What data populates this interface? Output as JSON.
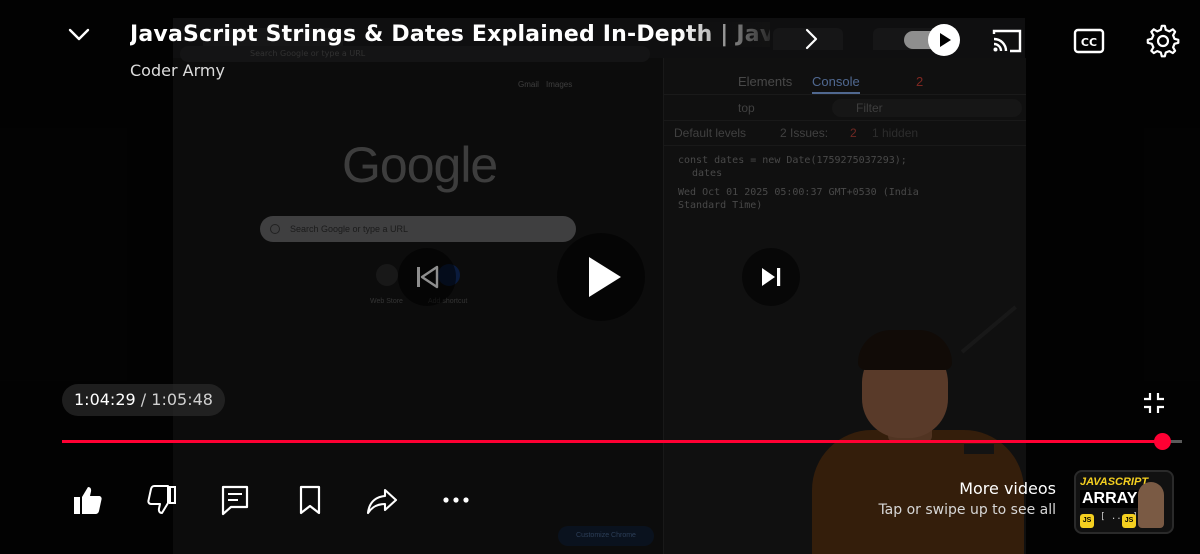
{
  "video": {
    "title": "JavaScript Strings & Dates Explained In-Depth | Javas",
    "channel": "Coder Army"
  },
  "playback": {
    "current_time": "1:04:29",
    "separator": "/",
    "duration": "1:05:48",
    "progress_fraction": 0.982,
    "state": "paused"
  },
  "autoplay": {
    "enabled": true
  },
  "more_videos": {
    "title": "More videos",
    "subtitle": "Tap or swipe up to see all",
    "next_thumbnail": {
      "label_top": "JAVASCRIPT",
      "label_main": "ARRAY",
      "label_bracket": "[ ... ]",
      "badge": "JS"
    }
  },
  "frame": {
    "chrome": {
      "address_placeholder": "Search Google or type a URL",
      "links": [
        "Gmail",
        "Images"
      ],
      "logo": "Google",
      "search_placeholder": "Search Google or type a URL",
      "shortcuts": [
        "Web Store",
        "Add shortcut"
      ],
      "customize_label": "Customize Chrome"
    },
    "devtools": {
      "tabs": [
        "Elements",
        "Console"
      ],
      "active_tab": "Console",
      "error_count": "2",
      "context": "top",
      "filter_placeholder": "Filter",
      "levels": "Default levels",
      "issues": "2 Issues:",
      "issues_count": "2",
      "hidden": "1 hidden",
      "input_line_1": "const dates = new Date(1759275037293);",
      "input_line_2": "dates",
      "output_line_1": "Wed Oct 01 2025 05:00:37 GMT+0530 (India",
      "output_line_2": "Standard Time)"
    }
  },
  "icons": {
    "collapse": "chevron-down-icon",
    "expand_title": "chevron-right-icon",
    "cast": "cast-icon",
    "captions": "closed-captions-icon",
    "settings": "gear-icon",
    "previous": "skip-previous-icon",
    "play": "play-icon",
    "next": "skip-next-icon",
    "fullscreen_exit": "fullscreen-exit-icon",
    "like": "thumbs-up-icon",
    "dislike": "thumbs-down-icon",
    "comments": "comment-icon",
    "save": "bookmark-icon",
    "share": "share-arrow-icon",
    "more": "more-horizontal-icon"
  },
  "colors": {
    "progress_played": "#ff0033",
    "progress_track": "rgba(255,255,255,0.35)",
    "text_primary": "#ffffff"
  }
}
